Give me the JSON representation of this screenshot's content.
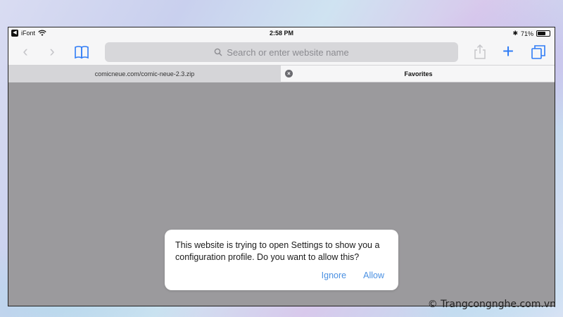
{
  "status_bar": {
    "carrier": "iFont",
    "time": "2:58 PM",
    "battery_percent": "71%",
    "battery_level": 0.71
  },
  "toolbar": {
    "address_placeholder": "Search or enter website name",
    "plus_symbol": "+",
    "back_symbol": "‹",
    "forward_symbol": "›"
  },
  "tabs": [
    {
      "label": "comicneue.com/comic-neue-2.3.zip",
      "active": false
    },
    {
      "label": "Favorites",
      "active": true
    }
  ],
  "dialog": {
    "message": "This website is trying to open Settings to show you a configuration profile. Do you want to allow this?",
    "ignore_label": "Ignore",
    "allow_label": "Allow"
  },
  "watermark": "© Trangcongnghe.com.vn",
  "colors": {
    "accent": "#2f7cf6",
    "content_bg": "#9b9a9d",
    "chrome_bg": "#f6f6f7"
  }
}
